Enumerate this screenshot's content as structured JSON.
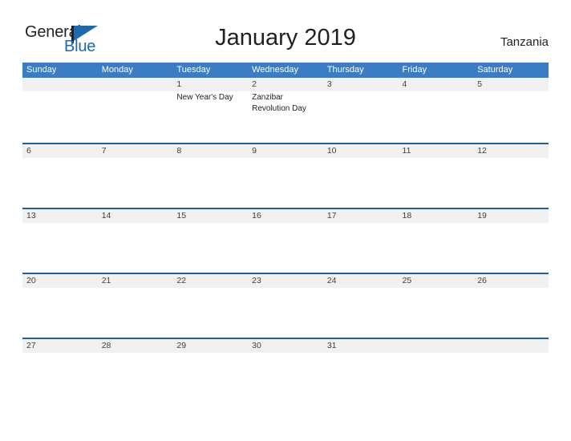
{
  "logo": {
    "word_one": "General",
    "word_two": "Blue",
    "flag_icon": "flag-triangle-icon"
  },
  "header": {
    "title": "January 2019",
    "region": "Tanzania"
  },
  "colors": {
    "header_blue": "#3b7dc4",
    "divider_blue": "#1f6099",
    "band_gray": "#f1f1f1",
    "logo_blue": "#1f6aa8",
    "text_dark": "#231f20"
  },
  "calendar": {
    "weekdays": [
      "Sunday",
      "Monday",
      "Tuesday",
      "Wednesday",
      "Thursday",
      "Friday",
      "Saturday"
    ],
    "weeks": [
      [
        {
          "day": "",
          "events": []
        },
        {
          "day": "",
          "events": []
        },
        {
          "day": "1",
          "events": [
            "New Year's Day"
          ]
        },
        {
          "day": "2",
          "events": [
            "Zanzibar Revolution Day"
          ]
        },
        {
          "day": "3",
          "events": []
        },
        {
          "day": "4",
          "events": []
        },
        {
          "day": "5",
          "events": []
        }
      ],
      [
        {
          "day": "6",
          "events": []
        },
        {
          "day": "7",
          "events": []
        },
        {
          "day": "8",
          "events": []
        },
        {
          "day": "9",
          "events": []
        },
        {
          "day": "10",
          "events": []
        },
        {
          "day": "11",
          "events": []
        },
        {
          "day": "12",
          "events": []
        }
      ],
      [
        {
          "day": "13",
          "events": []
        },
        {
          "day": "14",
          "events": []
        },
        {
          "day": "15",
          "events": []
        },
        {
          "day": "16",
          "events": []
        },
        {
          "day": "17",
          "events": []
        },
        {
          "day": "18",
          "events": []
        },
        {
          "day": "19",
          "events": []
        }
      ],
      [
        {
          "day": "20",
          "events": []
        },
        {
          "day": "21",
          "events": []
        },
        {
          "day": "22",
          "events": []
        },
        {
          "day": "23",
          "events": []
        },
        {
          "day": "24",
          "events": []
        },
        {
          "day": "25",
          "events": []
        },
        {
          "day": "26",
          "events": []
        }
      ],
      [
        {
          "day": "27",
          "events": []
        },
        {
          "day": "28",
          "events": []
        },
        {
          "day": "29",
          "events": []
        },
        {
          "day": "30",
          "events": []
        },
        {
          "day": "31",
          "events": []
        },
        {
          "day": "",
          "events": []
        },
        {
          "day": "",
          "events": []
        }
      ]
    ]
  }
}
